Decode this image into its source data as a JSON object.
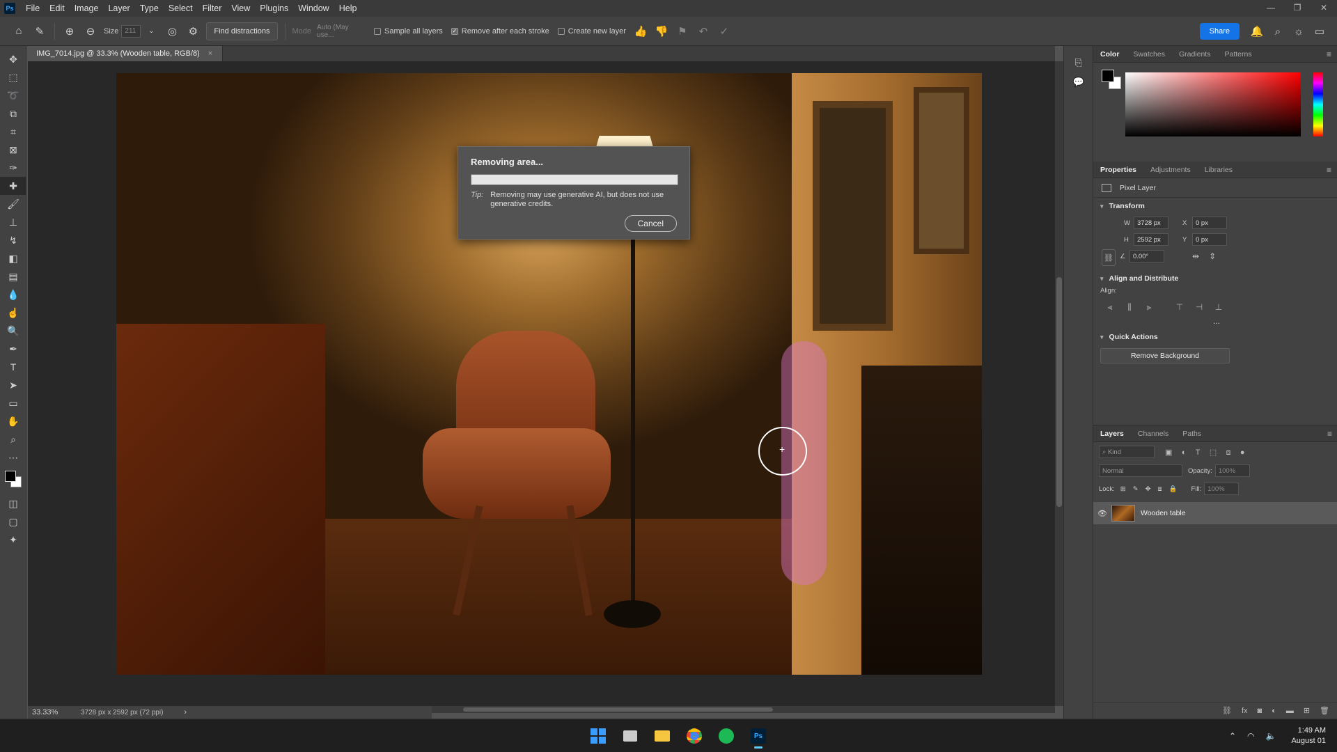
{
  "app": {
    "logo": "Ps"
  },
  "menu": [
    "File",
    "Edit",
    "Image",
    "Layer",
    "Type",
    "Select",
    "Filter",
    "View",
    "Plugins",
    "Window",
    "Help"
  ],
  "options": {
    "size_label": "Size",
    "size_value": "211",
    "find_distractions": "Find distractions",
    "mode_label": "Mode",
    "mode_value": "Auto (May use...",
    "sample_all_layers": "Sample all layers",
    "remove_after_stroke": "Remove after each stroke",
    "create_new_layer": "Create new layer",
    "share": "Share",
    "sample_all_checked": false,
    "remove_after_checked": true,
    "create_new_checked": false
  },
  "document": {
    "tab_title": "IMG_7014.jpg @ 33.3% (Wooden table, RGB/8)",
    "close": "×"
  },
  "status": {
    "zoom": "33.33%",
    "dimensions": "3728 px x 2592 px (72 ppi)",
    "arrow": "›"
  },
  "dialog": {
    "title": "Removing area...",
    "progress": 0,
    "tip_label": "Tip:",
    "tip_text": "Removing may use generative AI, but does not use generative credits.",
    "cancel": "Cancel"
  },
  "color_panel": {
    "tabs": [
      "Color",
      "Swatches",
      "Gradients",
      "Patterns"
    ]
  },
  "properties": {
    "tabs": [
      "Properties",
      "Adjustments",
      "Libraries"
    ],
    "layer_type": "Pixel Layer",
    "transform_title": "Transform",
    "w_label": "W",
    "w_value": "3728 px",
    "h_label": "H",
    "h_value": "2592 px",
    "x_label": "X",
    "x_value": "0 px",
    "y_label": "Y",
    "y_value": "0 px",
    "angle_value": "0.00°",
    "align_title": "Align and Distribute",
    "align_label": "Align:",
    "more": "...",
    "quick_actions_title": "Quick Actions",
    "remove_background": "Remove Background"
  },
  "layers": {
    "tabs": [
      "Layers",
      "Channels",
      "Paths"
    ],
    "kind_placeholder": "Kind",
    "blend_mode": "Normal",
    "opacity_label": "Opacity:",
    "opacity_value": "100%",
    "lock_label": "Lock:",
    "fill_label": "Fill:",
    "fill_value": "100%",
    "layer_name": "Wooden table"
  },
  "taskbar": {
    "time": "1:49 AM",
    "date": "August 01"
  }
}
